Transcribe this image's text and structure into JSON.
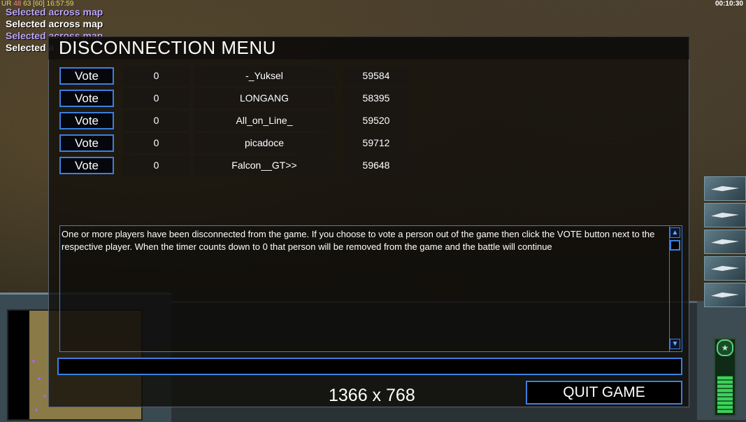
{
  "overlay": {
    "debug": {
      "prefix": "UR",
      "a": "48",
      "b": "63",
      "c": "[60]",
      "time": "16:57:59"
    },
    "game_clock": "00:10:30",
    "selection_messages": [
      {
        "text": "Selected across map",
        "color": "purple"
      },
      {
        "text": "Selected across map",
        "color": "white"
      },
      {
        "text": "Selected across map",
        "color": "purple"
      },
      {
        "text": "Selected a",
        "color": "white"
      }
    ]
  },
  "dialog": {
    "title": "DISCONNECTION MENU",
    "vote_label": "Vote",
    "players": [
      {
        "votes": "0",
        "name": "-_Yuksel",
        "timer": "59584"
      },
      {
        "votes": "0",
        "name": "LONGANG",
        "timer": "58395"
      },
      {
        "votes": "0",
        "name": "All_on_Line_",
        "timer": "59520"
      },
      {
        "votes": "0",
        "name": "picadoce",
        "timer": "59712"
      },
      {
        "votes": "0",
        "name": "Falcon__GT>>",
        "timer": "59648"
      }
    ],
    "message": "One or more players have been disconnected from the game. If you choose to vote a person out of the game then click the VOTE button next to the respective player. When the timer counts down to 0 that person will be removed from the game and the battle will continue",
    "chat_value": "",
    "resolution": "1366 x 768",
    "quit_label": "QUIT GAME"
  },
  "hud": {
    "power_level": 0.55,
    "side_buttons": [
      "bomber-icon",
      "jet-icon",
      "radar-icon",
      "satellite-icon",
      "helicopter-icon"
    ]
  }
}
